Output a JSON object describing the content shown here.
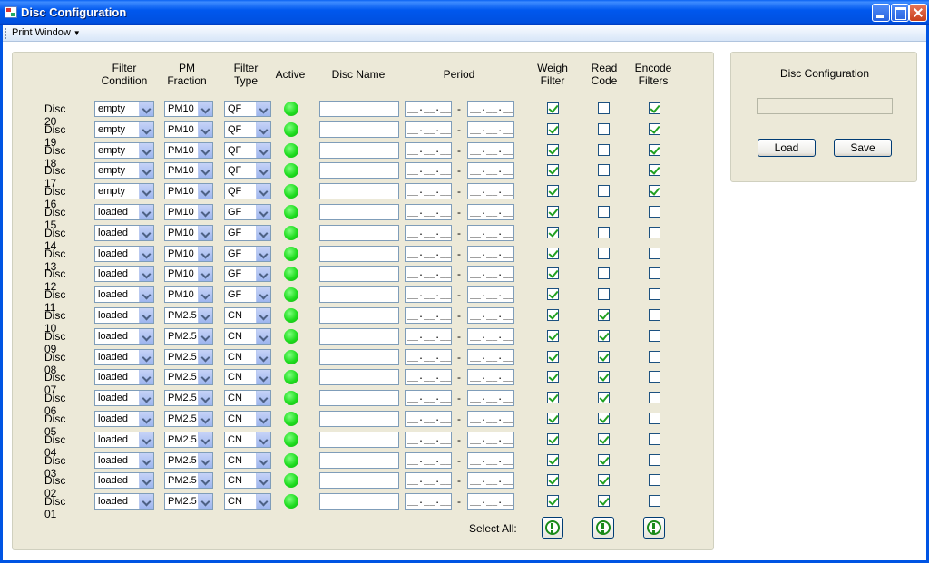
{
  "window": {
    "title": "Disc Configuration"
  },
  "menu": {
    "print_label": "Print Window"
  },
  "headers": {
    "filter_condition": "Filter\nCondition",
    "pm_fraction": "PM\nFraction",
    "filter_type": "Filter\nType",
    "active": "Active",
    "disc_name": "Disc Name",
    "period": "Period",
    "weigh_filter": "Weigh\nFilter",
    "read_code": "Read\nCode",
    "encode_filters": "Encode\nFilters"
  },
  "discs": [
    {
      "label": "Disc 20",
      "condition": "empty",
      "pm": "PM10",
      "type": "QF",
      "name": "",
      "period_from": "__.__.____",
      "period_to": "__.__.____",
      "weigh": true,
      "read": false,
      "encode": true
    },
    {
      "label": "Disc 19",
      "condition": "empty",
      "pm": "PM10",
      "type": "QF",
      "name": "",
      "period_from": "__.__.____",
      "period_to": "__.__.____",
      "weigh": true,
      "read": false,
      "encode": true
    },
    {
      "label": "Disc 18",
      "condition": "empty",
      "pm": "PM10",
      "type": "QF",
      "name": "",
      "period_from": "__.__.____",
      "period_to": "__.__.____",
      "weigh": true,
      "read": false,
      "encode": true
    },
    {
      "label": "Disc 17",
      "condition": "empty",
      "pm": "PM10",
      "type": "QF",
      "name": "",
      "period_from": "__.__.____",
      "period_to": "__.__.____",
      "weigh": true,
      "read": false,
      "encode": true
    },
    {
      "label": "Disc 16",
      "condition": "empty",
      "pm": "PM10",
      "type": "QF",
      "name": "",
      "period_from": "__.__.____",
      "period_to": "__.__.____",
      "weigh": true,
      "read": false,
      "encode": true
    },
    {
      "label": "Disc 15",
      "condition": "loaded",
      "pm": "PM10",
      "type": "GF",
      "name": "",
      "period_from": "__.__.____",
      "period_to": "__.__.____",
      "weigh": true,
      "read": false,
      "encode": false
    },
    {
      "label": "Disc 14",
      "condition": "loaded",
      "pm": "PM10",
      "type": "GF",
      "name": "",
      "period_from": "__.__.____",
      "period_to": "__.__.____",
      "weigh": true,
      "read": false,
      "encode": false
    },
    {
      "label": "Disc 13",
      "condition": "loaded",
      "pm": "PM10",
      "type": "GF",
      "name": "",
      "period_from": "__.__.____",
      "period_to": "__.__.____",
      "weigh": true,
      "read": false,
      "encode": false
    },
    {
      "label": "Disc 12",
      "condition": "loaded",
      "pm": "PM10",
      "type": "GF",
      "name": "",
      "period_from": "__.__.____",
      "period_to": "__.__.____",
      "weigh": true,
      "read": false,
      "encode": false
    },
    {
      "label": "Disc 11",
      "condition": "loaded",
      "pm": "PM10",
      "type": "GF",
      "name": "",
      "period_from": "__.__.____",
      "period_to": "__.__.____",
      "weigh": true,
      "read": false,
      "encode": false
    },
    {
      "label": "Disc 10",
      "condition": "loaded",
      "pm": "PM2.5",
      "type": "CN",
      "name": "",
      "period_from": "__.__.____",
      "period_to": "__.__.____",
      "weigh": true,
      "read": true,
      "encode": false
    },
    {
      "label": "Disc 09",
      "condition": "loaded",
      "pm": "PM2.5",
      "type": "CN",
      "name": "",
      "period_from": "__.__.____",
      "period_to": "__.__.____",
      "weigh": true,
      "read": true,
      "encode": false
    },
    {
      "label": "Disc 08",
      "condition": "loaded",
      "pm": "PM2.5",
      "type": "CN",
      "name": "",
      "period_from": "__.__.____",
      "period_to": "__.__.____",
      "weigh": true,
      "read": true,
      "encode": false
    },
    {
      "label": "Disc 07",
      "condition": "loaded",
      "pm": "PM2.5",
      "type": "CN",
      "name": "",
      "period_from": "__.__.____",
      "period_to": "__.__.____",
      "weigh": true,
      "read": true,
      "encode": false
    },
    {
      "label": "Disc 06",
      "condition": "loaded",
      "pm": "PM2.5",
      "type": "CN",
      "name": "",
      "period_from": "__.__.____",
      "period_to": "__.__.____",
      "weigh": true,
      "read": true,
      "encode": false
    },
    {
      "label": "Disc 05",
      "condition": "loaded",
      "pm": "PM2.5",
      "type": "CN",
      "name": "",
      "period_from": "__.__.____",
      "period_to": "__.__.____",
      "weigh": true,
      "read": true,
      "encode": false
    },
    {
      "label": "Disc 04",
      "condition": "loaded",
      "pm": "PM2.5",
      "type": "CN",
      "name": "",
      "period_from": "__.__.____",
      "period_to": "__.__.____",
      "weigh": true,
      "read": true,
      "encode": false
    },
    {
      "label": "Disc 03",
      "condition": "loaded",
      "pm": "PM2.5",
      "type": "CN",
      "name": "",
      "period_from": "__.__.____",
      "period_to": "__.__.____",
      "weigh": true,
      "read": true,
      "encode": false
    },
    {
      "label": "Disc 02",
      "condition": "loaded",
      "pm": "PM2.5",
      "type": "CN",
      "name": "",
      "period_from": "__.__.____",
      "period_to": "__.__.____",
      "weigh": true,
      "read": true,
      "encode": false
    },
    {
      "label": "Disc 01",
      "condition": "loaded",
      "pm": "PM2.5",
      "type": "CN",
      "name": "",
      "period_from": "__.__.____",
      "period_to": "__.__.____",
      "weigh": true,
      "read": true,
      "encode": false
    }
  ],
  "period_separator": "-",
  "select_all": {
    "label": "Select All:"
  },
  "config_panel": {
    "title": "Disc Configuration",
    "field_value": "",
    "load_label": "Load",
    "save_label": "Save"
  },
  "colors": {
    "titlebar": "#0054e3",
    "panel_bg": "#ece9d8",
    "active_led": "#1fdc1f",
    "check": "#21a121"
  },
  "icons": {
    "app": "app-window-icon",
    "select_all": "exclamation-circle-icon"
  }
}
